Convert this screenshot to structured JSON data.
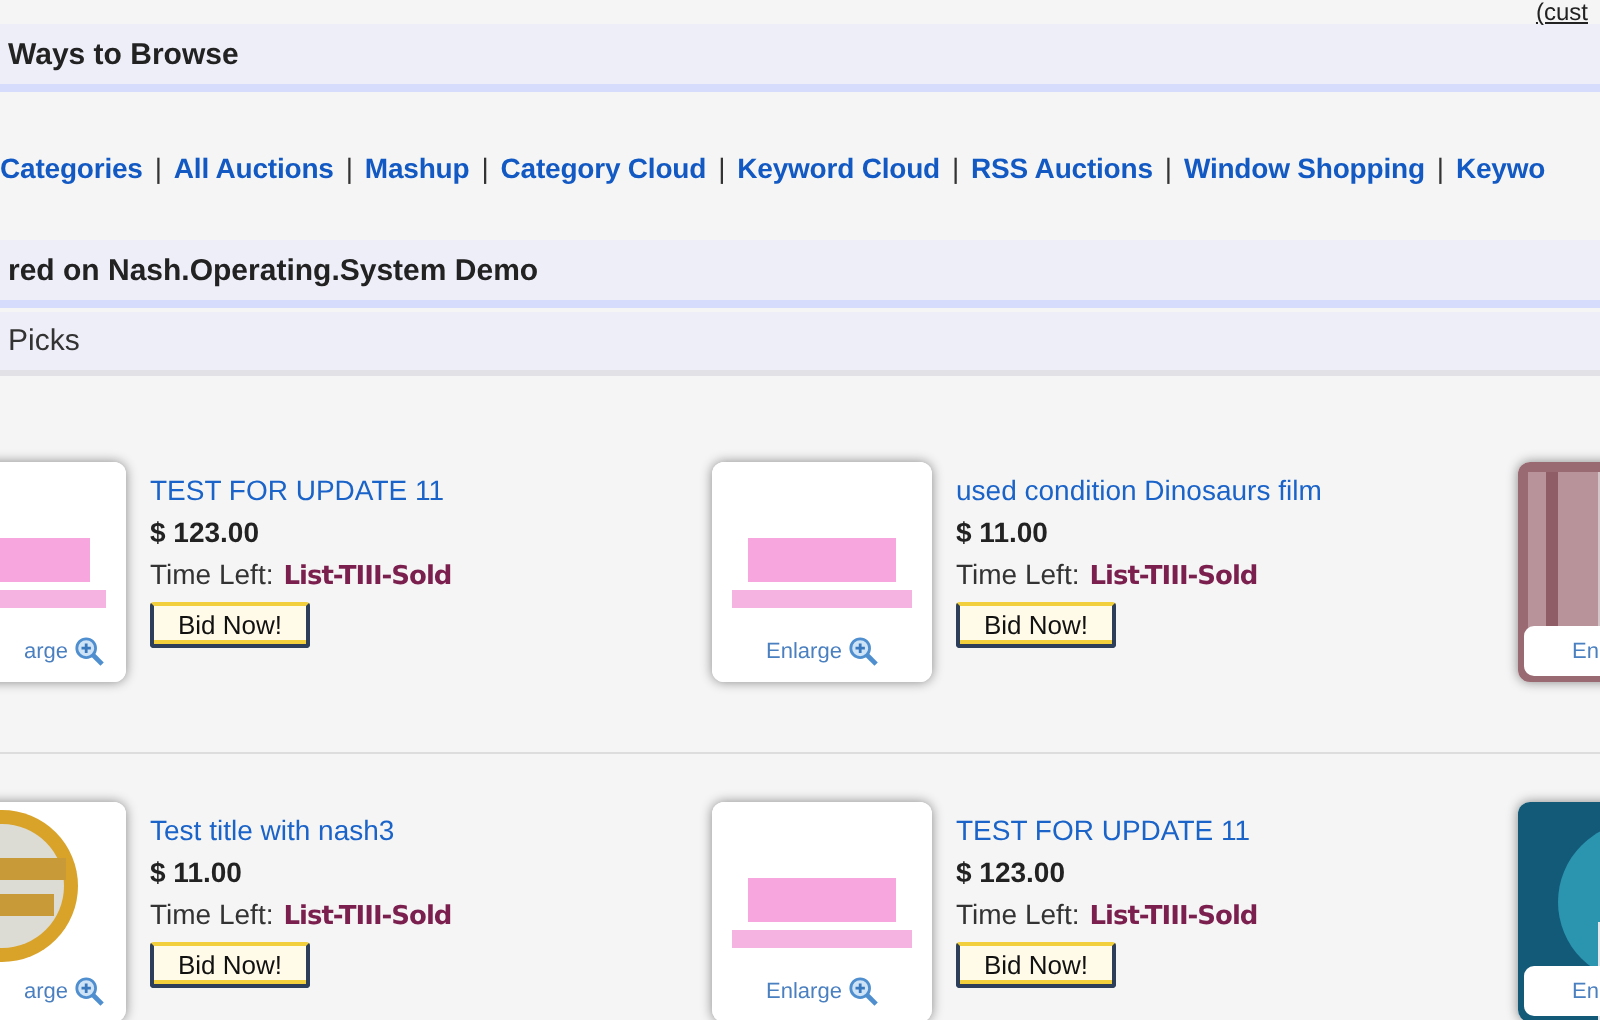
{
  "top_link": "(cust",
  "browse_header": "Ways to Browse",
  "browse_links": [
    {
      "kind": "link",
      "text": "Categories"
    },
    {
      "kind": "sep",
      "text": "|"
    },
    {
      "kind": "link",
      "text": "All Auctions"
    },
    {
      "kind": "sep",
      "text": "|"
    },
    {
      "kind": "link",
      "text": "Mashup"
    },
    {
      "kind": "sep",
      "text": "|"
    },
    {
      "kind": "link",
      "text": "Category Cloud"
    },
    {
      "kind": "sep",
      "text": "|"
    },
    {
      "kind": "link",
      "text": "Keyword Cloud"
    },
    {
      "kind": "sep",
      "text": "|"
    },
    {
      "kind": "link",
      "text": "RSS Auctions"
    },
    {
      "kind": "sep",
      "text": "|"
    },
    {
      "kind": "link",
      "text": "Window Shopping"
    },
    {
      "kind": "sep",
      "text": "|"
    },
    {
      "kind": "link",
      "text": "Keywo"
    }
  ],
  "featured_header": "red on Nash.Operating.System Demo",
  "picks_header": "Picks",
  "rows": [
    {
      "items": [
        {
          "kind": "picture",
          "enlarge": "arge",
          "title": "TEST FOR UPDATE 11",
          "price": "$ 123.00",
          "time_label": "Time Left:",
          "time_value": "List-TIII-Sold",
          "button": "Bid Now!"
        },
        {
          "kind": "picture",
          "enlarge": "Enlarge",
          "title": "used condition Dinosaurs film",
          "price": "$ 11.00",
          "time_label": "Time Left:",
          "time_value": "List-TIII-Sold",
          "button": "Bid Now!"
        },
        {
          "kind": "picture",
          "enlarge": "En"
        }
      ]
    },
    {
      "items": [
        {
          "kind": "picture",
          "enlarge": "arge",
          "title": "Test title with nash3",
          "price": "$ 11.00",
          "time_label": "Time Left:",
          "time_value": "List-TIII-Sold",
          "button": "Bid Now!"
        },
        {
          "kind": "picture",
          "enlarge": "Enlarge",
          "title": "TEST FOR UPDATE 11",
          "price": "$ 123.00",
          "time_label": "Time Left:",
          "time_value": "List-TIII-Sold",
          "button": "Bid Now!"
        },
        {
          "kind": "picture",
          "enlarge": "En"
        }
      ]
    }
  ]
}
